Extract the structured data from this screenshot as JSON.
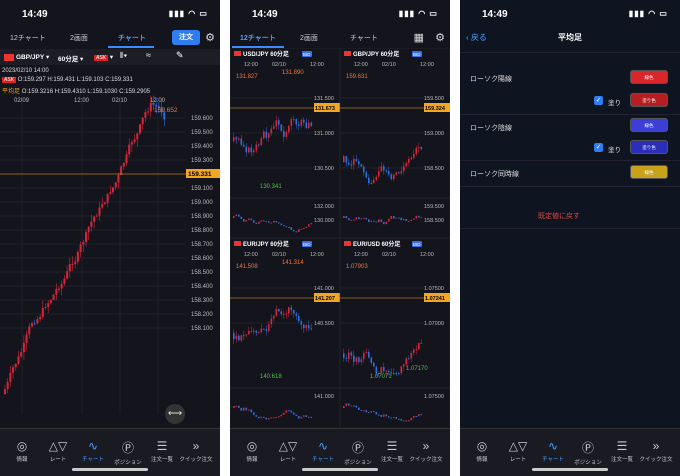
{
  "common": {
    "time": "14:49",
    "status_icons": "▮▮▮ ◠ ▭",
    "nav": [
      {
        "label": "情報",
        "icon": "globe-icon",
        "glyph": "◎"
      },
      {
        "label": "レート",
        "icon": "rate-icon",
        "glyph": "△▽"
      },
      {
        "label": "チャート",
        "icon": "chart-icon",
        "glyph": "∿"
      },
      {
        "label": "ポジション",
        "icon": "position-icon",
        "glyph": "Ⓟ"
      },
      {
        "label": "注文一覧",
        "icon": "orders-icon",
        "glyph": "☰"
      },
      {
        "label": "クイック注文",
        "icon": "quick-order-icon",
        "glyph": "»"
      }
    ]
  },
  "screen1": {
    "tabs": [
      "12チャート",
      "2画面",
      "チャート"
    ],
    "order_button": "注文",
    "pair": "GBP/JPY",
    "timeframe": "60分足",
    "ask_tag": "ASK",
    "date": "2023/02/10 14:00",
    "ask_badge": "ASK",
    "ohlc": "O:159.297 H:159.431 L:159.103 C:159.331",
    "avg_label": "平均足",
    "avg_ohlc": "O:159.3216 H:159.4310 L:159.1030 C:159.2905",
    "x_labels": [
      "02/09",
      "12:00",
      "02/10",
      "12:00"
    ],
    "y_labels": [
      "159.600",
      "159.500",
      "159.400",
      "159.300",
      "159.200",
      "159.100",
      "159.000",
      "158.900",
      "158.800",
      "158.700",
      "158.600",
      "158.500",
      "158.400",
      "158.300",
      "158.200",
      "158.100"
    ],
    "high_label": "159.652",
    "price_badge": "159.331"
  },
  "screen2": {
    "tabs": [
      "12チャート",
      "2画面",
      "チャート"
    ],
    "panels": [
      {
        "pair": "USD/JPY",
        "tf": "60分足",
        "bid": "BID",
        "x_labels": [
          "12:00",
          "02/10",
          "12:00"
        ],
        "y_labels": [
          "131.500",
          "131.000",
          "130.500"
        ],
        "sub_labels": [
          "132.000",
          "130.000"
        ],
        "high1": "131.827",
        "high2": "131.890",
        "low": "130.341",
        "price": "131.673"
      },
      {
        "pair": "GBP/JPY",
        "tf": "60分足",
        "bid": "BID",
        "x_labels": [
          "12:00",
          "02/10",
          "12:00"
        ],
        "y_labels": [
          "159.500",
          "159.000",
          "158.500"
        ],
        "sub_labels": [
          "159.500",
          "158.500"
        ],
        "high1": "159.631",
        "high2": "",
        "low": "",
        "price": "159.324"
      },
      {
        "pair": "EUR/JPY",
        "tf": "60分足",
        "bid": "BID",
        "x_labels": [
          "12:00",
          "02/10",
          "12:00"
        ],
        "y_labels": [
          "141.000",
          "140.500"
        ],
        "sub_labels": [
          "141.000"
        ],
        "high1": "141.508",
        "high2": "141.314",
        "low": "140.618",
        "price": "141.207"
      },
      {
        "pair": "EUR/USD",
        "tf": "60分足",
        "bid": "BID",
        "x_labels": [
          "12:00",
          "02/10",
          "12:00"
        ],
        "y_labels": [
          "1.07500",
          "1.07000"
        ],
        "sub_labels": [
          "1.07500"
        ],
        "high1": "1.07903",
        "high2": "",
        "low": "1.07071",
        "low2": "1.07170",
        "price": "1.07241"
      }
    ]
  },
  "screen3": {
    "back": "戻る",
    "title": "平均足",
    "rows": [
      {
        "label": "ローソク陽線",
        "btn1": "線色",
        "check_label": "塗り",
        "btn2": "塗り色",
        "color": "#d8262a",
        "color2": "#b81d22"
      },
      {
        "label": "ローソク陰線",
        "btn1": "線色",
        "check_label": "塗り",
        "btn2": "塗り色",
        "color": "#3b3fd8",
        "color2": "#2a2eb8"
      },
      {
        "label": "ローソク同時線",
        "btn1": "線色",
        "color": "#c9a21b"
      }
    ],
    "reset": "既定値に戻す"
  }
}
